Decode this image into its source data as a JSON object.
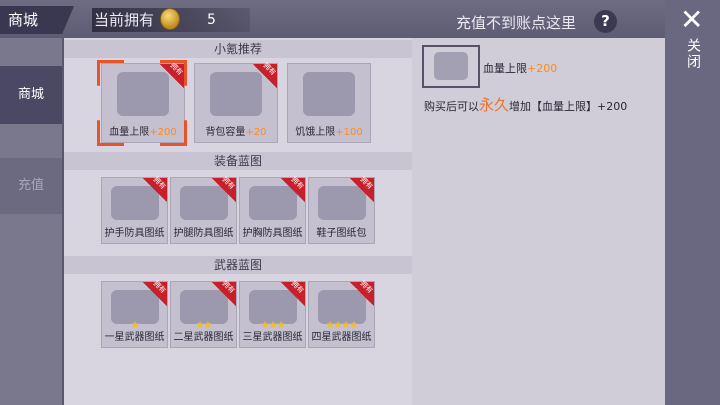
{
  "header": {
    "title": "商城",
    "owned_label": "当前拥有",
    "coin_icon": "coin-icon",
    "coin_value": "5",
    "recharge_text": "充值不到账点这里",
    "help_icon": "?"
  },
  "sidebar": {
    "tabs": [
      {
        "label": "商城",
        "active": true
      },
      {
        "label": "充值",
        "active": false
      }
    ]
  },
  "sections": [
    {
      "title": "小氪推荐",
      "items": [
        {
          "name": "血量上限",
          "bonus": "+200",
          "owned": "拥有",
          "icon": "heart-plus-icon",
          "selected": true
        },
        {
          "name": "背包容量",
          "bonus": "+20",
          "owned": "拥有",
          "icon": "backpack-icon"
        },
        {
          "name": "饥饿上限",
          "bonus": "+100",
          "owned": "",
          "icon": "stomach-plus-icon"
        }
      ]
    },
    {
      "title": "装备蓝图",
      "items": [
        {
          "name": "护手防具图纸",
          "owned": "拥有",
          "icon": "blueprint-icon"
        },
        {
          "name": "护腿防具图纸",
          "owned": "拥有",
          "icon": "blueprint-icon"
        },
        {
          "name": "护胸防具图纸",
          "owned": "拥有",
          "icon": "blueprint-icon"
        },
        {
          "name": "鞋子图纸包",
          "owned": "拥有",
          "icon": "blueprint-icon"
        }
      ]
    },
    {
      "title": "武器蓝图",
      "items": [
        {
          "name": "一星武器图纸",
          "owned": "拥有",
          "stars": "★",
          "icon": "blueprint-icon"
        },
        {
          "name": "二星武器图纸",
          "owned": "拥有",
          "stars": "★★",
          "icon": "blueprint-icon"
        },
        {
          "name": "三星武器图纸",
          "owned": "拥有",
          "stars": "★★★",
          "icon": "blueprint-icon"
        },
        {
          "name": "四星武器图纸",
          "owned": "拥有",
          "stars": "★★★★",
          "icon": "blueprint-icon"
        }
      ]
    }
  ],
  "detail": {
    "icon": "heart-plus-icon",
    "name": "血量上限",
    "bonus": "+200",
    "desc_prefix": "购买后可以",
    "desc_permanent": "永久",
    "desc_suffix": "增加【血量上限】+200"
  },
  "close": {
    "icon": "✕",
    "label": "关闭"
  },
  "colors": {
    "accent_orange": "#ff8a1a",
    "owned_ribbon": "#c8202a",
    "selection": "#e8542a"
  }
}
